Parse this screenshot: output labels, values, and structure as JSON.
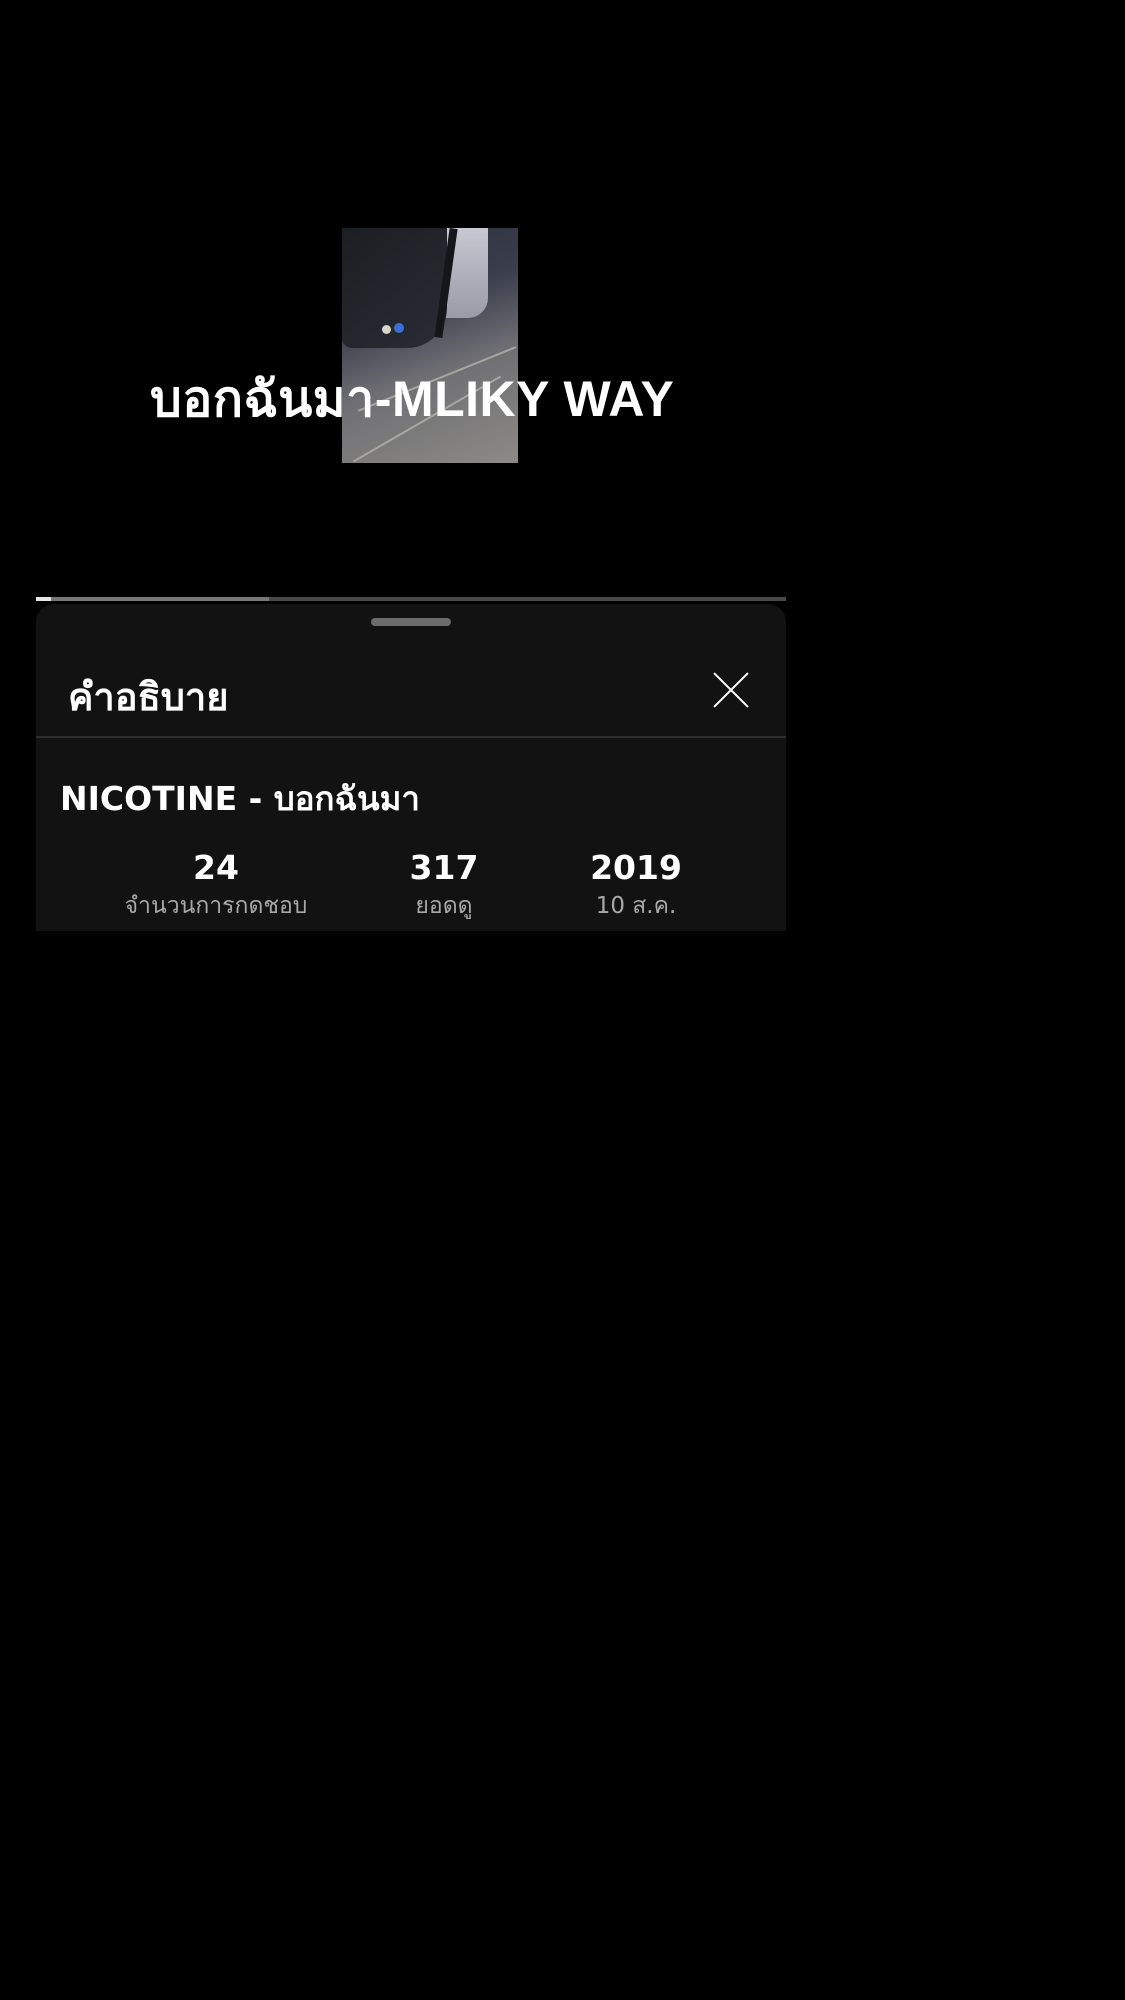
{
  "video": {
    "overlay_title": "บอกฉันมา-MLIKY WAY"
  },
  "progress": {
    "played_fraction": 0.02,
    "buffered_fraction": 0.31
  },
  "description_panel": {
    "title": "คำอธิบาย",
    "close_icon": "close-icon",
    "video_name": "NICOTINE - บอกฉันมา",
    "stats": {
      "likes": {
        "value": "24",
        "label": "จำนวนการกดชอบ"
      },
      "views": {
        "value": "317",
        "label": "ยอดดู"
      },
      "date": {
        "value": "2019",
        "label": "10 ส.ค."
      }
    }
  },
  "colors": {
    "background": "#000000",
    "sheet": "#121212",
    "secondary_text": "#a8a8a8"
  }
}
